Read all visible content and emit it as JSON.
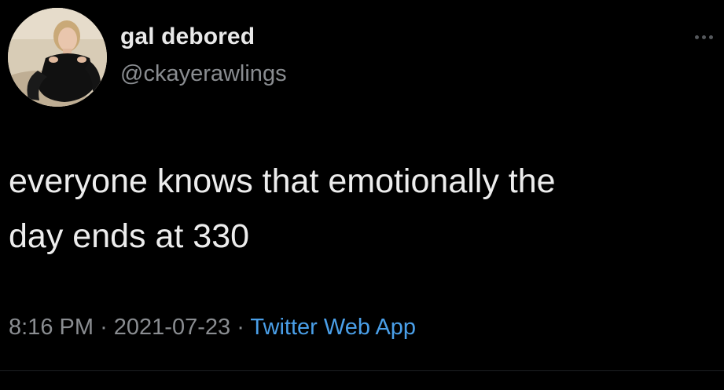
{
  "user": {
    "display_name": "gal debored",
    "handle": "@ckayerawlings"
  },
  "tweet": {
    "text": "everyone knows that emotionally the\nday ends at 330",
    "time": "8:16 PM",
    "separator": "·",
    "date": "2021-07-23",
    "source": "Twitter Web App"
  },
  "icons": {
    "more": "more-options-icon",
    "avatar": "profile-photo"
  },
  "colors": {
    "background": "#000000",
    "text": "#ededed",
    "secondary": "#8a8d91",
    "link": "#4a9fe8"
  }
}
